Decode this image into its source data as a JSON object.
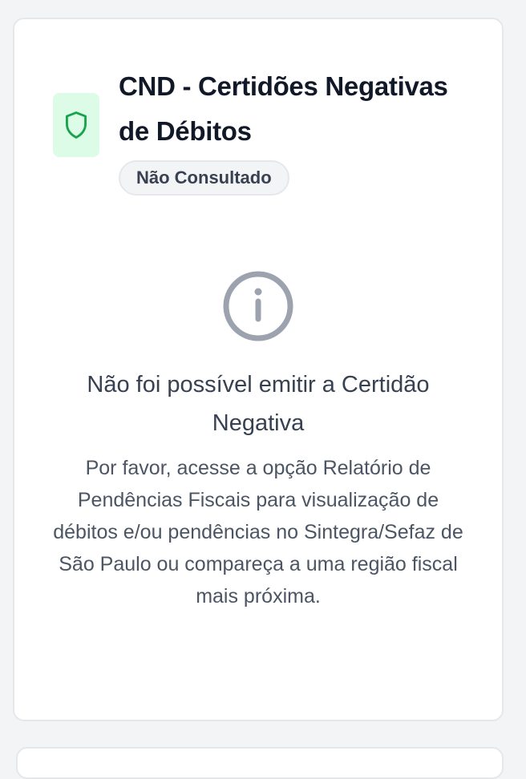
{
  "card": {
    "title": "CND - Certidões Negativas de Débitos",
    "status_badge": "Não Consultado",
    "icon": "shield-icon",
    "accent_color": "#16a34a",
    "icon_background": "#dcfce7"
  },
  "status": {
    "icon": "info-circle-icon",
    "heading": "Não foi possível emitir a Certidão Negativa",
    "message": "Por favor, acesse a opção Relatório de Pendências Fiscais para visualização de débitos e/ou pendências no Sintegra/Sefaz de São Paulo ou compareça a uma região fiscal mais próxima."
  }
}
